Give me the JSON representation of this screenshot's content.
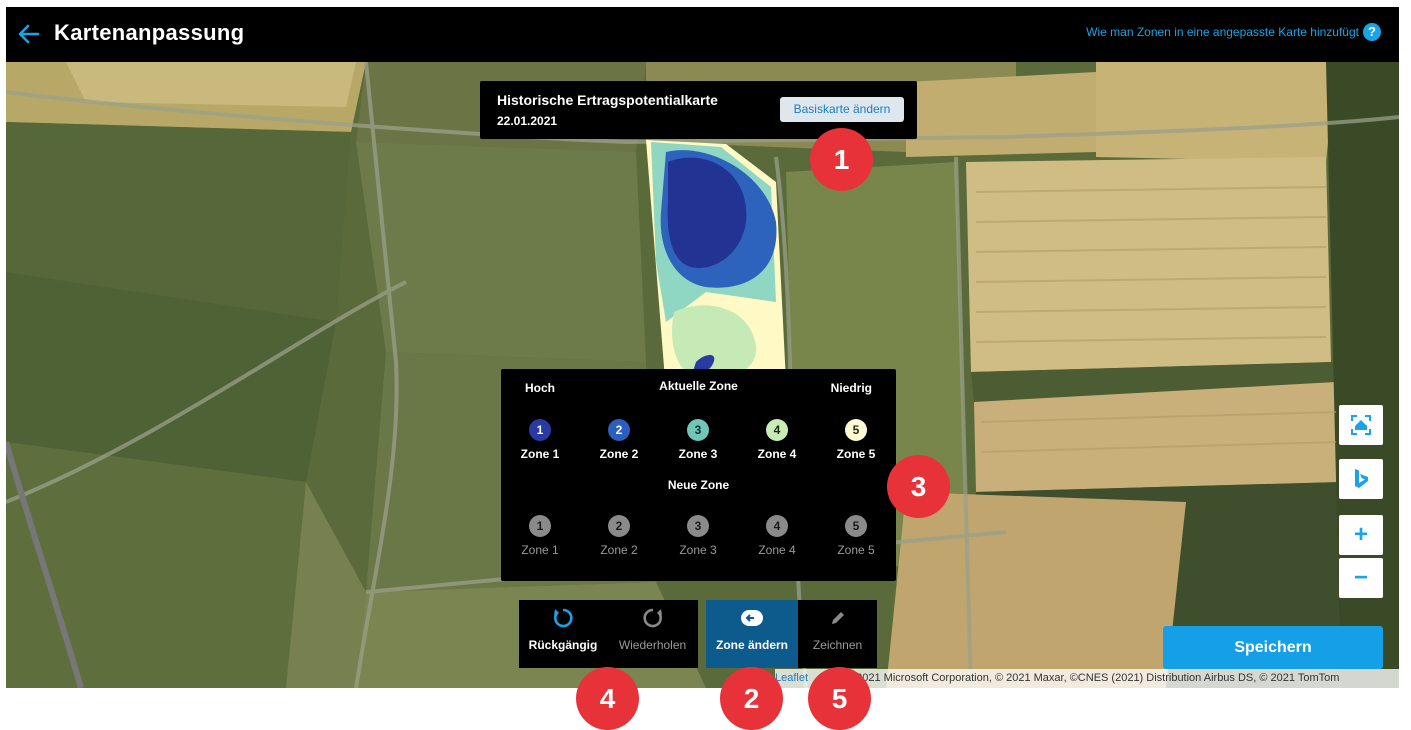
{
  "header": {
    "back_icon": "arrow-left-icon",
    "title": "Kartenanpassung",
    "help_link": "Wie man Zonen in eine angepasste Karte hinzufügt",
    "help_icon_glyph": "?"
  },
  "basemap": {
    "title": "Historische Ertragspotentialkarte",
    "date": "22.01.2021",
    "change_button": "Basiskarte ändern"
  },
  "zone_panel": {
    "high_label": "Hoch",
    "current_label": "Aktuelle Zone",
    "low_label": "Niedrig",
    "new_label": "Neue Zone",
    "current_zones": [
      {
        "number": "1",
        "label": "Zone 1",
        "color": "#2a3aa3"
      },
      {
        "number": "2",
        "label": "Zone 2",
        "color": "#2c5fbd"
      },
      {
        "number": "3",
        "label": "Zone 3",
        "color": "#6fc7b6"
      },
      {
        "number": "4",
        "label": "Zone 4",
        "color": "#c9ecb7"
      },
      {
        "number": "5",
        "label": "Zone 5",
        "color": "#fffbd6"
      }
    ],
    "new_zones": [
      {
        "number": "1",
        "label": "Zone 1"
      },
      {
        "number": "2",
        "label": "Zone 2"
      },
      {
        "number": "3",
        "label": "Zone 3"
      },
      {
        "number": "4",
        "label": "Zone 4"
      },
      {
        "number": "5",
        "label": "Zone 5"
      }
    ]
  },
  "tools": {
    "undo": "Rückgängig",
    "redo": "Wiederholen",
    "change_zone": "Zone ändern",
    "draw": "Zeichnen"
  },
  "map_controls": {
    "home_icon": "home-frame-icon",
    "bing_icon": "bing-icon",
    "zoom_in": "+",
    "zoom_out": "−"
  },
  "save_button": "Speichern",
  "attribution": {
    "leaflet": "Leaflet",
    "text": "2021 Microsoft Corporation, © 2021 Maxar, ©CNES (2021) Distribution Airbus DS, © 2021 TomTom"
  },
  "badges": [
    "1",
    "2",
    "3",
    "4",
    "5"
  ],
  "colors": {
    "accent": "#1aa3e8",
    "badge": "#e8323a",
    "active_tool": "#0d5a8c"
  }
}
